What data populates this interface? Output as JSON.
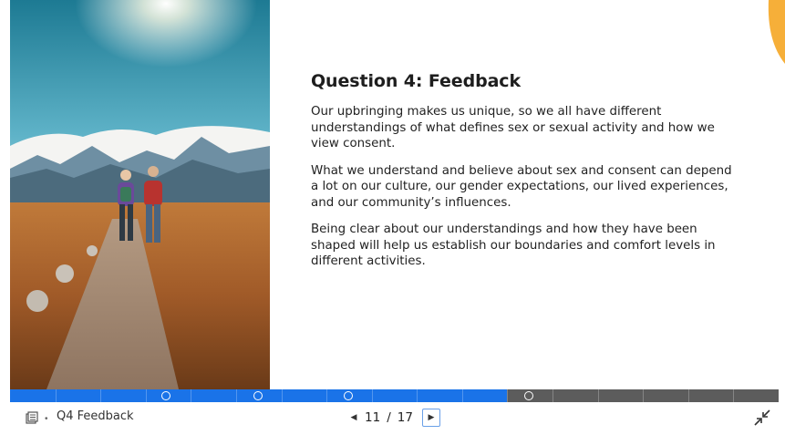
{
  "slide": {
    "title": "Question 4: Feedback",
    "paragraphs": [
      "Our upbringing makes us unique, so we all have different understandings of what defines sex or sexual activity and how we view consent.",
      "What we understand and believe about sex and consent can depend a lot on our culture, our gender expectations, our lived experiences, and our community’s influences.",
      "Being clear about our understandings and how they have been shaped will help us establish our boundaries and comfort levels in different activities."
    ]
  },
  "progress": {
    "current_slide": 11,
    "total_slides": 17,
    "fraction_complete": 0.647,
    "accent_color": "#1a73e8",
    "track_color": "#5c5c5c"
  },
  "bottom_bar": {
    "outline_icon": "outline-icon",
    "slide_title": "Q4 Feedback",
    "current": "11",
    "separator": "/",
    "total": "17",
    "prev_icon": "◀",
    "next_icon": "▶",
    "exit_fullscreen_icon": "shrink-icon"
  },
  "colors": {
    "corner_tab": "#f5a623"
  }
}
